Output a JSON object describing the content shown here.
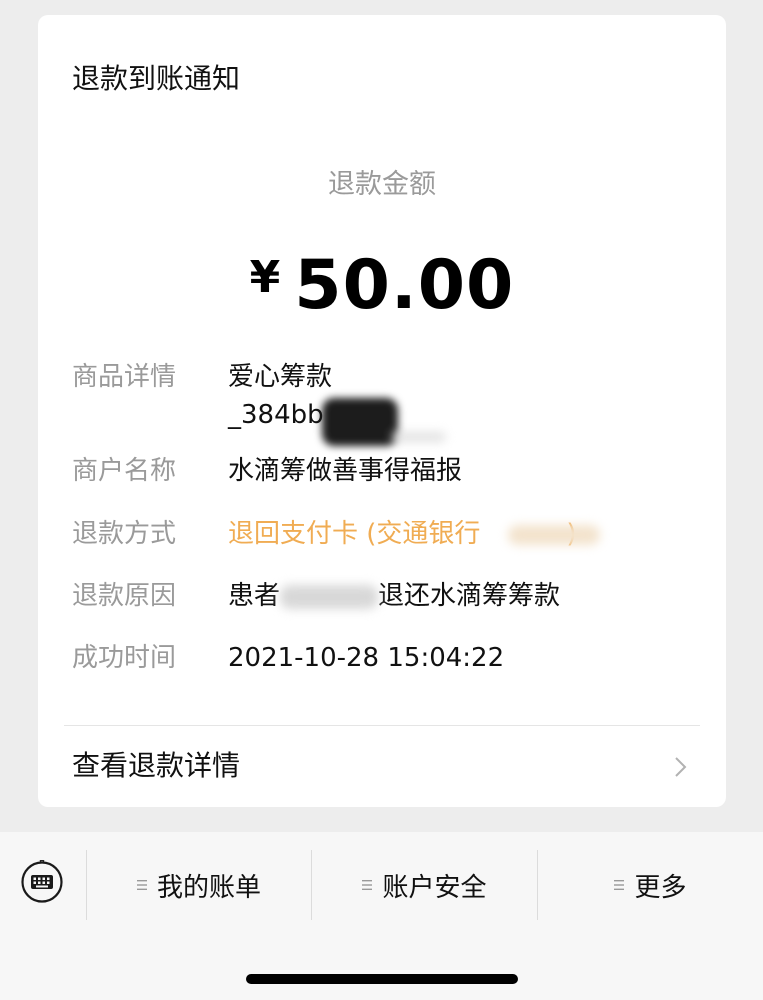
{
  "card": {
    "title": "退款到账通知",
    "amount_label": "退款金额",
    "currency": "¥",
    "amount": "50.00"
  },
  "rows": {
    "product": {
      "label": "商品详情",
      "value_line1": "爱心筹款",
      "value_line2": "_384bb"
    },
    "merchant": {
      "label": "商户名称",
      "value": "水滴筹做善事得福报"
    },
    "method": {
      "label": "退款方式",
      "value": "退回支付卡 (交通银行",
      "value_suffix": ")"
    },
    "reason": {
      "label": "退款原因",
      "value_prefix": "患者",
      "value_suffix": "退还水滴筹筹款"
    },
    "time": {
      "label": "成功时间",
      "value": "2021-10-28 15:04:22"
    }
  },
  "details_link": {
    "label": "查看退款详情",
    "icon": "chevron-right-icon"
  },
  "bottom_menu": {
    "keyboard_icon": "keyboard-icon",
    "items": [
      {
        "label": "我的账单",
        "icon": "menu-lines-icon"
      },
      {
        "label": "账户安全",
        "icon": "menu-lines-icon"
      },
      {
        "label": "更多",
        "icon": "menu-lines-icon"
      }
    ]
  },
  "colors": {
    "background": "#ededed",
    "card": "#ffffff",
    "label_gray": "#9a9a9a",
    "text": "#111111",
    "refund_method_orange": "#f0ac53"
  }
}
